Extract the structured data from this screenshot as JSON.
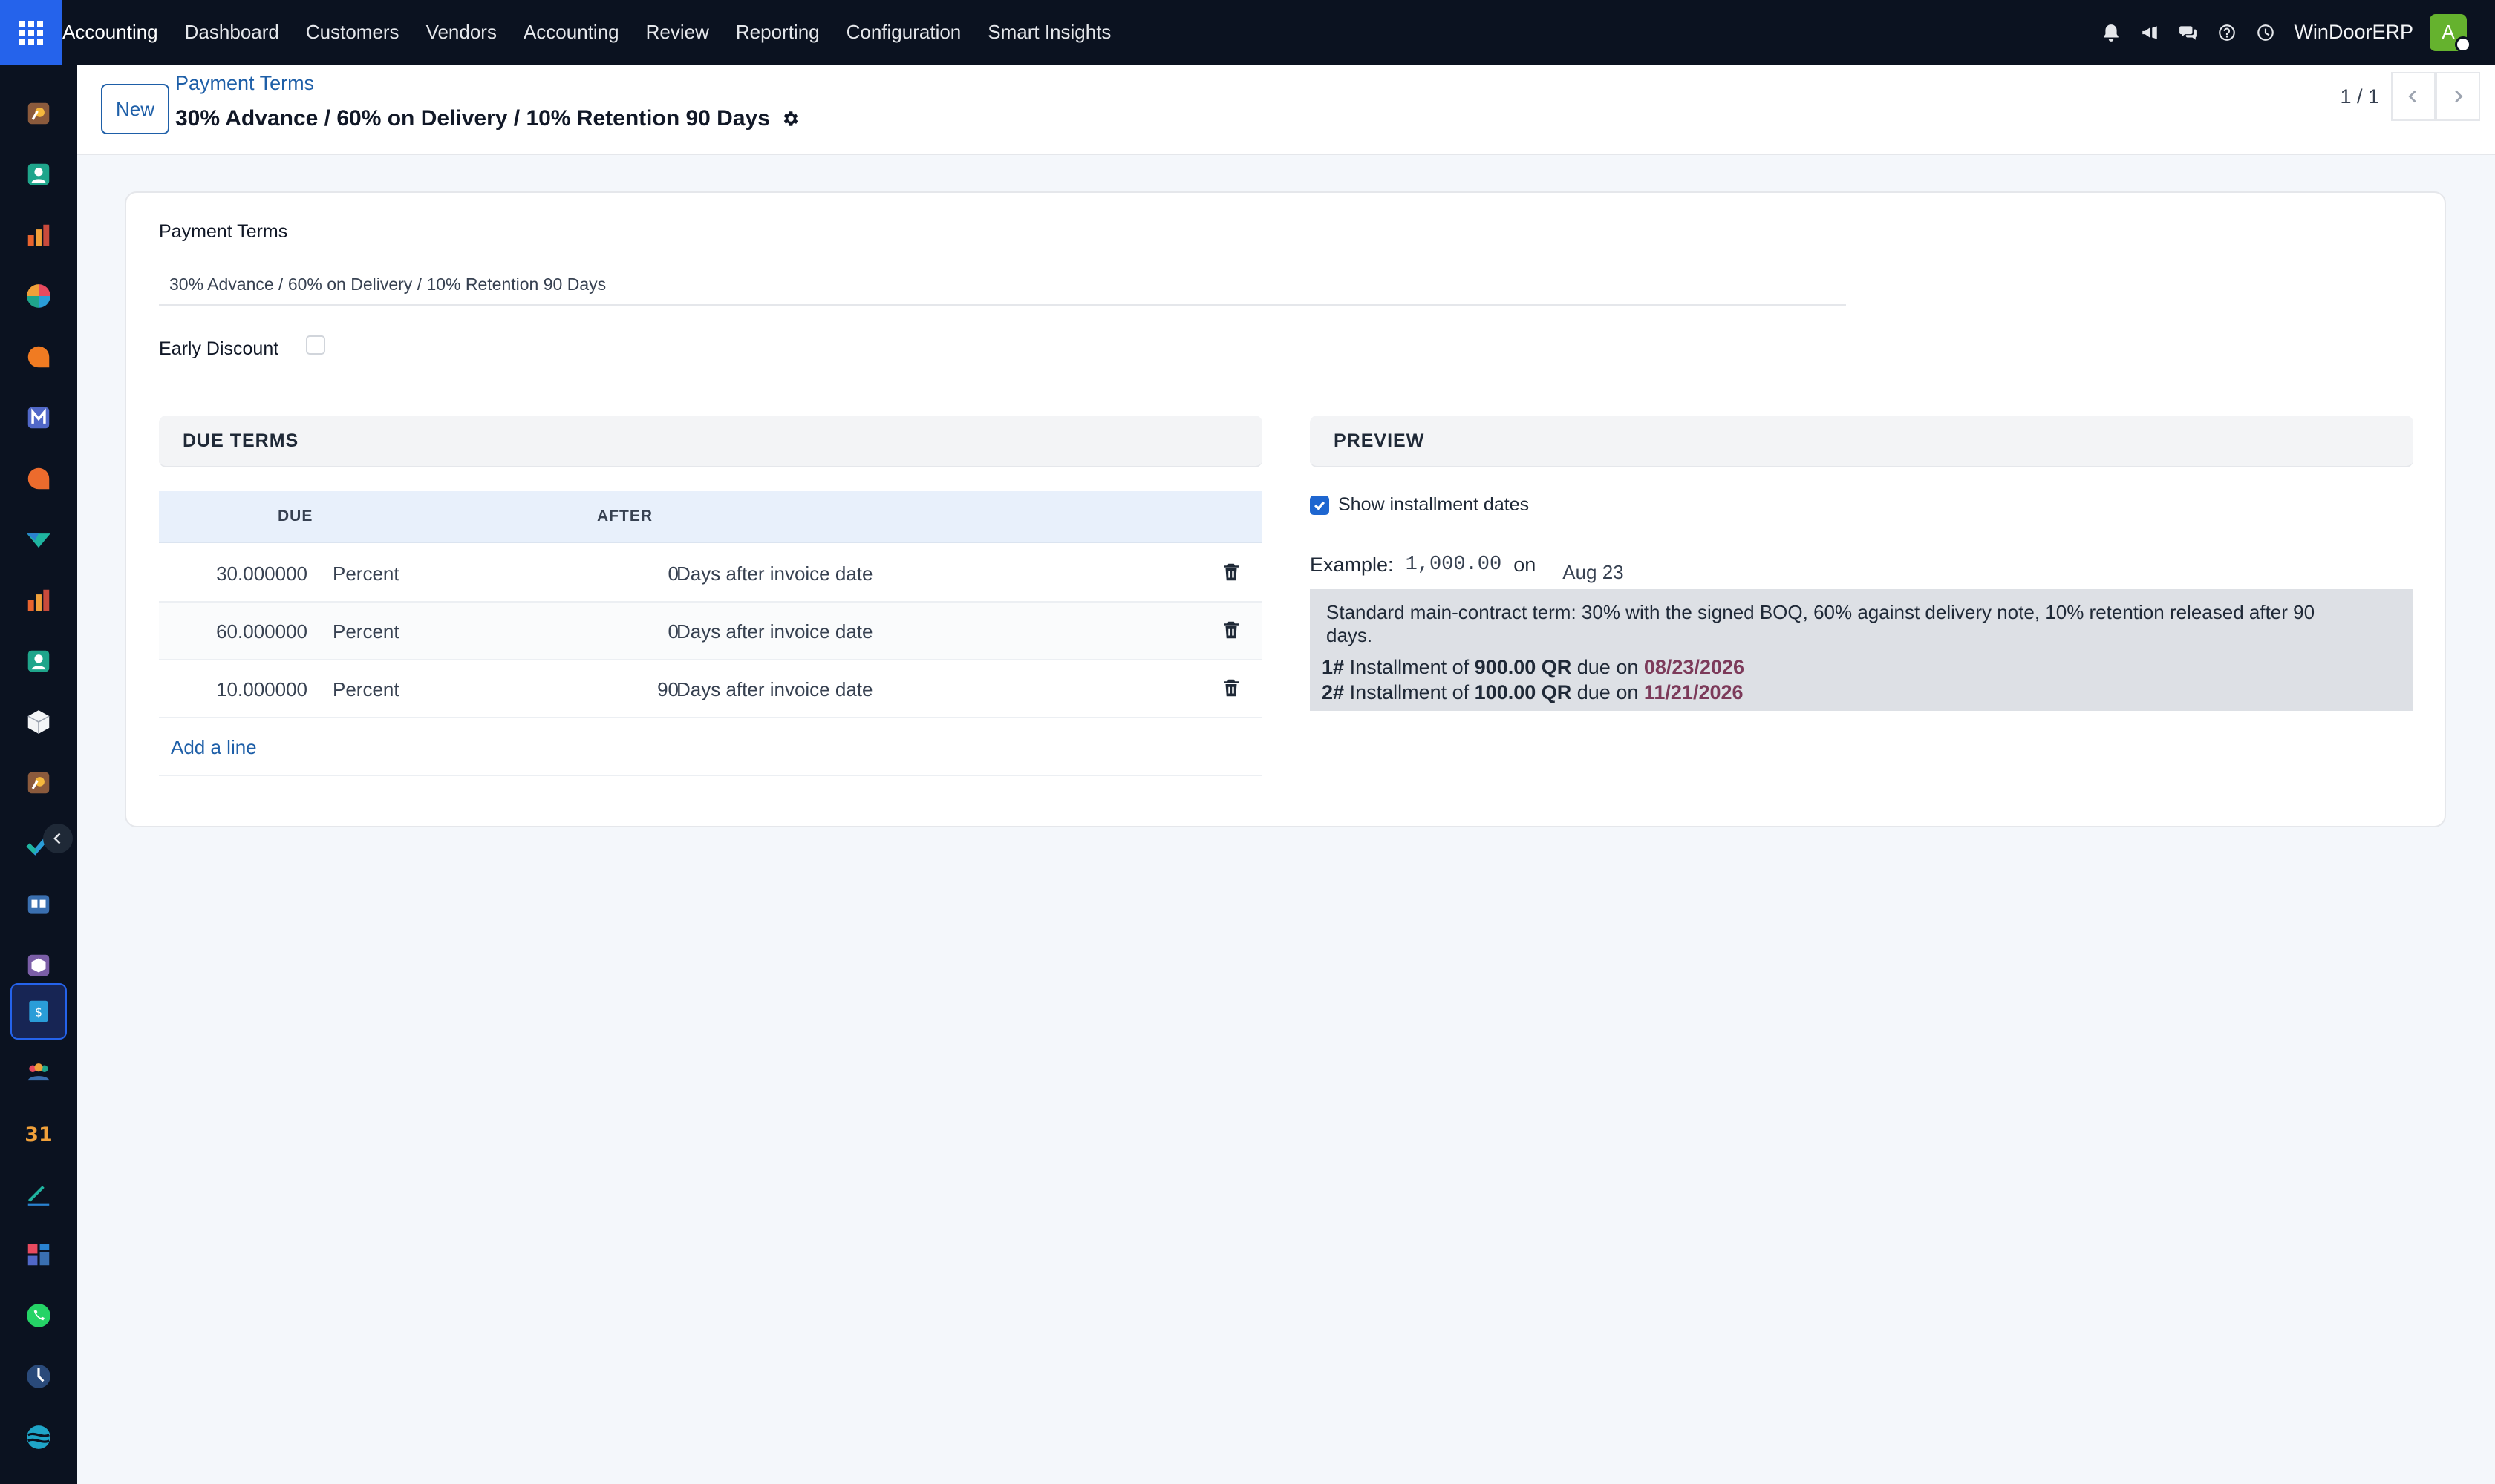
{
  "navbar": {
    "brand": "Accounting",
    "menu": [
      "Dashboard",
      "Customers",
      "Vendors",
      "Accounting",
      "Review",
      "Reporting",
      "Configuration",
      "Smart Insights"
    ],
    "company": "WinDoorERP",
    "avatar_letter": "A",
    "icons": [
      "bell-icon",
      "megaphone-icon",
      "chat-icon",
      "help-icon",
      "clock-icon"
    ]
  },
  "sidebar": {
    "apps": [
      "discuss-app-icon",
      "contacts-app-icon",
      "reporting-app-icon",
      "dashboard-app-icon",
      "livechat-app-icon",
      "mail-app-icon",
      "chat-app-icon",
      "sales-app-icon",
      "bar-chart-app-icon",
      "employee-app-icon",
      "inventory-app-icon",
      "discuss-2-app-icon",
      "todo-app-icon",
      "knowledge-app-icon",
      "package-app-icon",
      "invoicing-app-icon",
      "team-app-icon",
      "calendar-app-icon",
      "sign-app-icon",
      "dashboards-app-icon",
      "whatsapp-app-icon",
      "timer-app-icon",
      "website-app-icon"
    ],
    "active_index": 15,
    "calendar_label": "31"
  },
  "control_panel": {
    "new_label": "New",
    "breadcrumb": "Payment Terms",
    "title": "30% Advance / 60% on Delivery / 10% Retention 90 Days",
    "pager": "1 / 1"
  },
  "form": {
    "name_label": "Payment Terms",
    "name_value": "30% Advance / 60% on Delivery / 10% Retention 90 Days",
    "early_discount_label": "Early Discount",
    "early_discount_checked": false
  },
  "due_terms": {
    "header": "DUE TERMS",
    "columns": {
      "due": "DUE",
      "after": "AFTER"
    },
    "rows": [
      {
        "value": "30.000000",
        "type": "Percent",
        "days": "0",
        "option": "Days after invoice date"
      },
      {
        "value": "60.000000",
        "type": "Percent",
        "days": "0",
        "option": "Days after invoice date"
      },
      {
        "value": "10.000000",
        "type": "Percent",
        "days": "90",
        "option": "Days after invoice date"
      }
    ],
    "add_line": "Add a line"
  },
  "preview": {
    "header": "PREVIEW",
    "show_dates_label": "Show installment dates",
    "show_dates_checked": true,
    "example_label": "Example:",
    "example_amount": "1,000.00",
    "on_label": "on",
    "example_date": "Aug 23",
    "description": "Standard main-contract term: 30% with the signed BOQ, 60% against delivery note, 10% retention released after 90 days.",
    "installments": [
      {
        "index": "1#",
        "prefix": "Installment of",
        "amount": "900.00 QR",
        "mid": "due on",
        "date": "08/23/2026"
      },
      {
        "index": "2#",
        "prefix": "Installment of",
        "amount": "100.00 QR",
        "mid": "due on",
        "date": "11/21/2026"
      }
    ]
  },
  "colors": {
    "navbar_bg": "#0b1220",
    "primary": "#1e5fa8",
    "apps_button": "#2563eb",
    "avatar": "#65b22e",
    "date_accent": "#7c3a5a"
  }
}
